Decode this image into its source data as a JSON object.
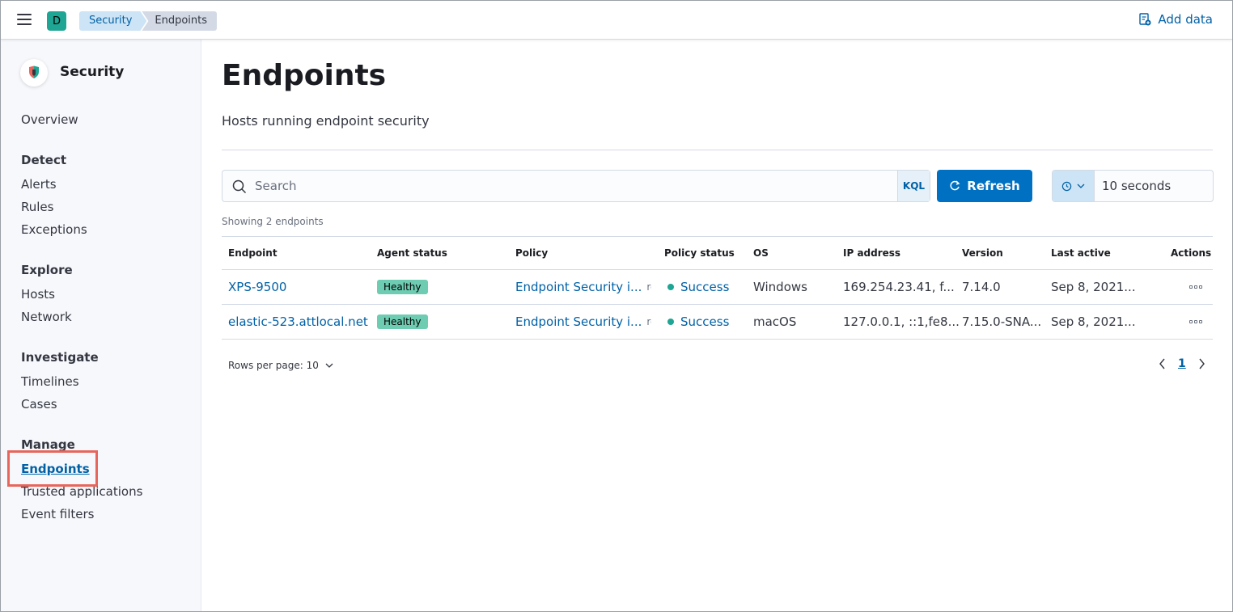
{
  "header": {
    "space_initial": "D",
    "breadcrumbs": [
      "Security",
      "Endpoints"
    ],
    "add_data_label": "Add data"
  },
  "sidebar": {
    "title": "Security",
    "overview": "Overview",
    "groups": [
      {
        "label": "Detect",
        "items": [
          "Alerts",
          "Rules",
          "Exceptions"
        ]
      },
      {
        "label": "Explore",
        "items": [
          "Hosts",
          "Network"
        ]
      },
      {
        "label": "Investigate",
        "items": [
          "Timelines",
          "Cases"
        ]
      },
      {
        "label": "Manage",
        "items": [
          "Endpoints",
          "Trusted applications",
          "Event filters"
        ]
      }
    ],
    "active_item": "Endpoints"
  },
  "main": {
    "title": "Endpoints",
    "subtitle": "Hosts running endpoint security",
    "search": {
      "placeholder": "Search",
      "kql_label": "KQL"
    },
    "refresh_label": "Refresh",
    "refresh_interval": "10 seconds",
    "showing_text": "Showing 2 endpoints",
    "table": {
      "columns": [
        "Endpoint",
        "Agent status",
        "Policy",
        "Policy status",
        "OS",
        "IP address",
        "Version",
        "Last active",
        "Actions"
      ],
      "rows": [
        {
          "endpoint": "XPS-9500",
          "agent_status": "Healthy",
          "policy": "Endpoint Security i...",
          "rev": "rev",
          "policy_status": "Success",
          "os": "Windows",
          "ip": "169.254.23.41, f...",
          "version": "7.14.0",
          "last_active": "Sep 8, 2021..."
        },
        {
          "endpoint": "elastic-523.attlocal.net",
          "agent_status": "Healthy",
          "policy": "Endpoint Security i...",
          "rev": "rev",
          "policy_status": "Success",
          "os": "macOS",
          "ip": "127.0.0.1, ::1,fe8...",
          "version": "7.15.0-SNA...",
          "last_active": "Sep 8, 2021..."
        }
      ]
    },
    "rows_per_page": "Rows per page: 10",
    "current_page": "1"
  },
  "colors": {
    "accent": "#0071c2",
    "link": "#0061a6",
    "healthy_badge": "#6dccb1",
    "success_dot": "#1ea593",
    "highlight": "#e7665c"
  }
}
